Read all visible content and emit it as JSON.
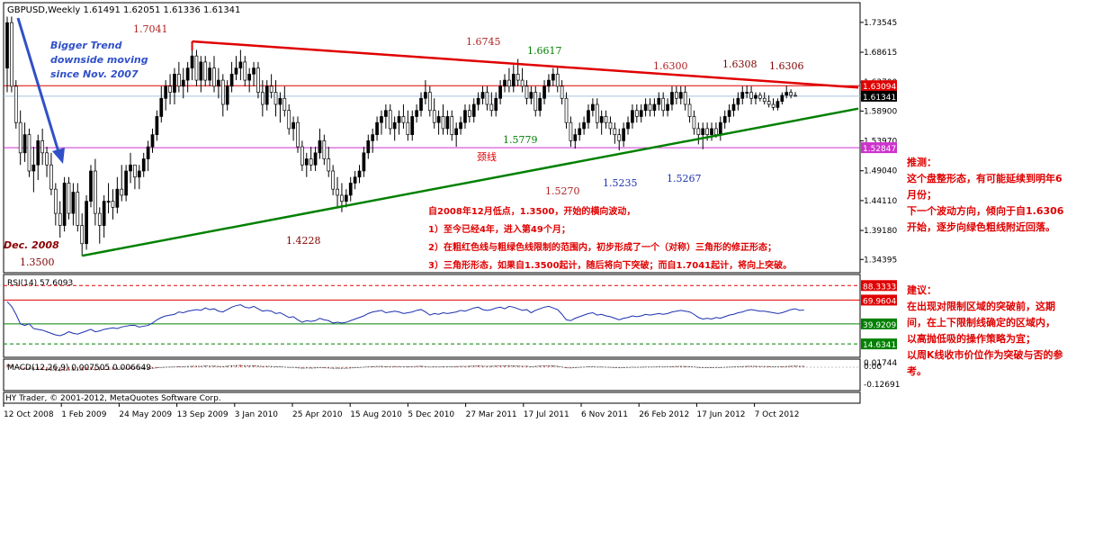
{
  "chart_data": {
    "type": "candlestick",
    "symbol_header": "GBPUSD,Weekly  1.61491 1.62051 1.61336 1.61341",
    "rsi_header": "RSI(14) 57.6093",
    "macd_header": "MACD(12,26,9) 0.007505 0.006649",
    "footer": "HY Trader, © 2001-2012, MetaQuotes Software Corp.",
    "price_range": [
      1.325,
      1.765
    ],
    "price_ticks": [
      "1.73545",
      "1.68615",
      "1.63700",
      "1.58900",
      "1.53970",
      "1.49040",
      "1.44110",
      "1.39180",
      "1.34395"
    ],
    "x_labels": [
      "12 Oct 2008",
      "1 Feb 2009",
      "24 May 2009",
      "13 Sep 2009",
      "3 Jan 2010",
      "25 Apr 2010",
      "15 Aug 2010",
      "5 Dec 2010",
      "27 Mar 2011",
      "17 Jul 2011",
      "6 Nov 2011",
      "26 Feb 2012",
      "17 Jun 2012",
      "7 Oct 2012"
    ],
    "price_tags": {
      "red_line": "1.63094",
      "current": "1.61341",
      "magenta_line": "1.52847"
    },
    "rsi_tags": [
      "88.3333",
      "69.9604",
      "39.9209",
      "14.6341"
    ],
    "macd_ticks": [
      "0.01744",
      "0.00",
      "-0.12691"
    ],
    "annotations": {
      "trend_note": [
        "Bigger Trend",
        "downside moving",
        "since Nov. 2007"
      ],
      "dec_2008": "Dec. 2008",
      "price_marks": [
        "1.7041",
        "1.6745",
        "1.6617",
        "1.6300",
        "1.6308",
        "1.6306",
        "1.5779",
        "1.5270",
        "1.5235",
        "1.5267",
        "1.4228",
        "1.3500"
      ],
      "neck_label": "颈线",
      "analysis": [
        "自2008年12月低点，1.3500，开始的横向波动，",
        "1）至今已经4年，进入第49个月；",
        "2）在粗红色线与粗绿色线限制的范围内，初步形成了一个（对称）三角形的修正形态；",
        "3）三角形形态，如果自1.3500起计，随后将向下突破；而自1.7041起计，将向上突破。"
      ]
    },
    "candles": [
      [
        1.66,
        1.745,
        1.62,
        1.735
      ],
      [
        1.735,
        1.745,
        1.62,
        1.63
      ],
      [
        1.63,
        1.64,
        1.56,
        1.57
      ],
      [
        1.57,
        1.59,
        1.5,
        1.52
      ],
      [
        1.52,
        1.57,
        1.505,
        1.55
      ],
      [
        1.55,
        1.56,
        1.48,
        1.49
      ],
      [
        1.49,
        1.53,
        1.455,
        1.5
      ],
      [
        1.5,
        1.55,
        1.475,
        1.54
      ],
      [
        1.54,
        1.56,
        1.5,
        1.52
      ],
      [
        1.52,
        1.53,
        1.48,
        1.5
      ],
      [
        1.5,
        1.52,
        1.45,
        1.46
      ],
      [
        1.46,
        1.47,
        1.4,
        1.42
      ],
      [
        1.42,
        1.44,
        1.38,
        1.4
      ],
      [
        1.4,
        1.48,
        1.39,
        1.47
      ],
      [
        1.47,
        1.48,
        1.41,
        1.42
      ],
      [
        1.42,
        1.47,
        1.4,
        1.455
      ],
      [
        1.455,
        1.47,
        1.39,
        1.4
      ],
      [
        1.4,
        1.42,
        1.35,
        1.37
      ],
      [
        1.37,
        1.45,
        1.36,
        1.44
      ],
      [
        1.44,
        1.5,
        1.43,
        1.49
      ],
      [
        1.49,
        1.51,
        1.4,
        1.42
      ],
      [
        1.42,
        1.43,
        1.37,
        1.4
      ],
      [
        1.4,
        1.45,
        1.38,
        1.44
      ],
      [
        1.44,
        1.47,
        1.42,
        1.44
      ],
      [
        1.44,
        1.46,
        1.41,
        1.43
      ],
      [
        1.43,
        1.48,
        1.42,
        1.46
      ],
      [
        1.46,
        1.5,
        1.44,
        1.45
      ],
      [
        1.45,
        1.5,
        1.44,
        1.49
      ],
      [
        1.49,
        1.52,
        1.47,
        1.5
      ],
      [
        1.5,
        1.5,
        1.46,
        1.48
      ],
      [
        1.48,
        1.5,
        1.46,
        1.49
      ],
      [
        1.49,
        1.52,
        1.48,
        1.51
      ],
      [
        1.51,
        1.54,
        1.49,
        1.53
      ],
      [
        1.53,
        1.56,
        1.52,
        1.55
      ],
      [
        1.55,
        1.59,
        1.54,
        1.58
      ],
      [
        1.58,
        1.63,
        1.57,
        1.61
      ],
      [
        1.61,
        1.64,
        1.59,
        1.63
      ],
      [
        1.63,
        1.65,
        1.6,
        1.62
      ],
      [
        1.62,
        1.66,
        1.6,
        1.65
      ],
      [
        1.65,
        1.67,
        1.62,
        1.63
      ],
      [
        1.63,
        1.66,
        1.61,
        1.64
      ],
      [
        1.64,
        1.67,
        1.62,
        1.66
      ],
      [
        1.66,
        1.7,
        1.64,
        1.68
      ],
      [
        1.68,
        1.69,
        1.63,
        1.64
      ],
      [
        1.64,
        1.68,
        1.62,
        1.67
      ],
      [
        1.67,
        1.68,
        1.63,
        1.64
      ],
      [
        1.64,
        1.67,
        1.63,
        1.66
      ],
      [
        1.66,
        1.68,
        1.62,
        1.63
      ],
      [
        1.63,
        1.66,
        1.61,
        1.64
      ],
      [
        1.64,
        1.65,
        1.58,
        1.6
      ],
      [
        1.6,
        1.64,
        1.59,
        1.63
      ],
      [
        1.63,
        1.67,
        1.62,
        1.65
      ],
      [
        1.65,
        1.68,
        1.64,
        1.66
      ],
      [
        1.66,
        1.69,
        1.64,
        1.67
      ],
      [
        1.67,
        1.68,
        1.63,
        1.64
      ],
      [
        1.64,
        1.66,
        1.62,
        1.65
      ],
      [
        1.65,
        1.67,
        1.63,
        1.66
      ],
      [
        1.66,
        1.67,
        1.61,
        1.62
      ],
      [
        1.62,
        1.64,
        1.58,
        1.6
      ],
      [
        1.6,
        1.64,
        1.59,
        1.63
      ],
      [
        1.63,
        1.65,
        1.61,
        1.62
      ],
      [
        1.62,
        1.64,
        1.58,
        1.6
      ],
      [
        1.6,
        1.62,
        1.57,
        1.61
      ],
      [
        1.61,
        1.63,
        1.58,
        1.59
      ],
      [
        1.59,
        1.6,
        1.55,
        1.56
      ],
      [
        1.56,
        1.58,
        1.54,
        1.57
      ],
      [
        1.57,
        1.58,
        1.52,
        1.53
      ],
      [
        1.53,
        1.54,
        1.49,
        1.5
      ],
      [
        1.5,
        1.52,
        1.48,
        1.51
      ],
      [
        1.51,
        1.53,
        1.49,
        1.5
      ],
      [
        1.5,
        1.53,
        1.49,
        1.52
      ],
      [
        1.52,
        1.56,
        1.51,
        1.54
      ],
      [
        1.54,
        1.55,
        1.5,
        1.51
      ],
      [
        1.51,
        1.53,
        1.48,
        1.49
      ],
      [
        1.49,
        1.5,
        1.45,
        1.46
      ],
      [
        1.46,
        1.48,
        1.43,
        1.45
      ],
      [
        1.45,
        1.47,
        1.422,
        1.44
      ],
      [
        1.44,
        1.46,
        1.43,
        1.45
      ],
      [
        1.45,
        1.48,
        1.44,
        1.47
      ],
      [
        1.47,
        1.49,
        1.46,
        1.48
      ],
      [
        1.48,
        1.5,
        1.47,
        1.49
      ],
      [
        1.49,
        1.53,
        1.48,
        1.52
      ],
      [
        1.52,
        1.55,
        1.51,
        1.54
      ],
      [
        1.54,
        1.56,
        1.52,
        1.55
      ],
      [
        1.55,
        1.58,
        1.54,
        1.57
      ],
      [
        1.57,
        1.59,
        1.55,
        1.58
      ],
      [
        1.58,
        1.6,
        1.56,
        1.59
      ],
      [
        1.59,
        1.6,
        1.55,
        1.56
      ],
      [
        1.56,
        1.58,
        1.54,
        1.57
      ],
      [
        1.57,
        1.59,
        1.55,
        1.58
      ],
      [
        1.58,
        1.6,
        1.56,
        1.57
      ],
      [
        1.57,
        1.59,
        1.54,
        1.55
      ],
      [
        1.55,
        1.59,
        1.54,
        1.58
      ],
      [
        1.58,
        1.6,
        1.57,
        1.59
      ],
      [
        1.59,
        1.62,
        1.58,
        1.61
      ],
      [
        1.61,
        1.64,
        1.6,
        1.62
      ],
      [
        1.62,
        1.63,
        1.58,
        1.59
      ],
      [
        1.59,
        1.61,
        1.56,
        1.57
      ],
      [
        1.57,
        1.59,
        1.55,
        1.58
      ],
      [
        1.58,
        1.6,
        1.55,
        1.56
      ],
      [
        1.56,
        1.59,
        1.55,
        1.58
      ],
      [
        1.58,
        1.59,
        1.54,
        1.55
      ],
      [
        1.55,
        1.57,
        1.53,
        1.56
      ],
      [
        1.56,
        1.58,
        1.55,
        1.57
      ],
      [
        1.57,
        1.6,
        1.56,
        1.59
      ],
      [
        1.59,
        1.6,
        1.57,
        1.58
      ],
      [
        1.58,
        1.61,
        1.57,
        1.6
      ],
      [
        1.6,
        1.62,
        1.59,
        1.61
      ],
      [
        1.61,
        1.63,
        1.6,
        1.62
      ],
      [
        1.62,
        1.63,
        1.59,
        1.6
      ],
      [
        1.6,
        1.62,
        1.58,
        1.59
      ],
      [
        1.59,
        1.62,
        1.58,
        1.61
      ],
      [
        1.61,
        1.64,
        1.6,
        1.63
      ],
      [
        1.63,
        1.65,
        1.62,
        1.64
      ],
      [
        1.64,
        1.66,
        1.62,
        1.63
      ],
      [
        1.63,
        1.665,
        1.62,
        1.65
      ],
      [
        1.65,
        1.675,
        1.63,
        1.64
      ],
      [
        1.64,
        1.66,
        1.62,
        1.63
      ],
      [
        1.63,
        1.64,
        1.6,
        1.61
      ],
      [
        1.61,
        1.63,
        1.6,
        1.62
      ],
      [
        1.62,
        1.63,
        1.58,
        1.59
      ],
      [
        1.59,
        1.62,
        1.58,
        1.61
      ],
      [
        1.61,
        1.64,
        1.6,
        1.63
      ],
      [
        1.63,
        1.65,
        1.62,
        1.64
      ],
      [
        1.64,
        1.66,
        1.63,
        1.65
      ],
      [
        1.65,
        1.662,
        1.62,
        1.63
      ],
      [
        1.63,
        1.64,
        1.6,
        1.61
      ],
      [
        1.61,
        1.62,
        1.56,
        1.57
      ],
      [
        1.57,
        1.58,
        1.53,
        1.54
      ],
      [
        1.54,
        1.56,
        1.527,
        1.55
      ],
      [
        1.55,
        1.57,
        1.54,
        1.56
      ],
      [
        1.56,
        1.58,
        1.55,
        1.57
      ],
      [
        1.57,
        1.6,
        1.56,
        1.59
      ],
      [
        1.59,
        1.61,
        1.58,
        1.6
      ],
      [
        1.6,
        1.61,
        1.56,
        1.57
      ],
      [
        1.57,
        1.59,
        1.55,
        1.58
      ],
      [
        1.58,
        1.59,
        1.56,
        1.57
      ],
      [
        1.57,
        1.58,
        1.55,
        1.56
      ],
      [
        1.56,
        1.57,
        1.535,
        1.55
      ],
      [
        1.55,
        1.56,
        1.524,
        1.54
      ],
      [
        1.54,
        1.57,
        1.53,
        1.56
      ],
      [
        1.56,
        1.58,
        1.55,
        1.57
      ],
      [
        1.57,
        1.6,
        1.56,
        1.59
      ],
      [
        1.59,
        1.6,
        1.57,
        1.58
      ],
      [
        1.58,
        1.6,
        1.57,
        1.59
      ],
      [
        1.59,
        1.61,
        1.58,
        1.6
      ],
      [
        1.6,
        1.61,
        1.58,
        1.59
      ],
      [
        1.59,
        1.61,
        1.58,
        1.6
      ],
      [
        1.6,
        1.62,
        1.59,
        1.61
      ],
      [
        1.61,
        1.62,
        1.58,
        1.59
      ],
      [
        1.59,
        1.61,
        1.58,
        1.6
      ],
      [
        1.6,
        1.63,
        1.59,
        1.62
      ],
      [
        1.62,
        1.63,
        1.6,
        1.61
      ],
      [
        1.61,
        1.63,
        1.6,
        1.62
      ],
      [
        1.62,
        1.63,
        1.59,
        1.6
      ],
      [
        1.6,
        1.61,
        1.57,
        1.58
      ],
      [
        1.58,
        1.59,
        1.55,
        1.56
      ],
      [
        1.56,
        1.57,
        1.534,
        1.55
      ],
      [
        1.55,
        1.57,
        1.526,
        1.56
      ],
      [
        1.56,
        1.57,
        1.54,
        1.55
      ],
      [
        1.55,
        1.57,
        1.54,
        1.56
      ],
      [
        1.56,
        1.57,
        1.545,
        1.55
      ],
      [
        1.55,
        1.58,
        1.54,
        1.57
      ],
      [
        1.57,
        1.59,
        1.56,
        1.58
      ],
      [
        1.58,
        1.6,
        1.57,
        1.59
      ],
      [
        1.59,
        1.61,
        1.58,
        1.6
      ],
      [
        1.6,
        1.62,
        1.59,
        1.61
      ],
      [
        1.61,
        1.63,
        1.6,
        1.62
      ],
      [
        1.62,
        1.631,
        1.61,
        1.62
      ],
      [
        1.62,
        1.63,
        1.6,
        1.61
      ],
      [
        1.61,
        1.62,
        1.6,
        1.615
      ],
      [
        1.615,
        1.62,
        1.605,
        1.61
      ],
      [
        1.61,
        1.62,
        1.6,
        1.605
      ],
      [
        1.605,
        1.615,
        1.595,
        1.6
      ],
      [
        1.6,
        1.61,
        1.59,
        1.595
      ],
      [
        1.595,
        1.61,
        1.59,
        1.605
      ],
      [
        1.605,
        1.62,
        1.6,
        1.615
      ],
      [
        1.615,
        1.6306,
        1.61,
        1.62
      ],
      [
        1.62,
        1.625,
        1.61,
        1.6149
      ],
      [
        1.6149,
        1.6205,
        1.6134,
        1.6134
      ]
    ],
    "rsi": [
      68,
      62,
      52,
      40,
      38,
      40,
      34,
      33,
      32,
      30,
      28,
      26,
      25,
      27,
      30,
      28,
      27,
      29,
      31,
      33,
      30,
      31,
      33,
      34,
      35,
      34,
      36,
      37,
      38,
      38,
      36,
      37,
      38,
      41,
      45,
      48,
      50,
      51,
      52,
      55,
      54,
      56,
      57,
      58,
      57,
      60,
      58,
      59,
      56,
      55,
      58,
      61,
      63,
      64,
      61,
      60,
      62,
      59,
      56,
      57,
      56,
      53,
      54,
      51,
      48,
      49,
      45,
      42,
      44,
      43,
      44,
      47,
      45,
      44,
      41,
      42,
      41,
      42,
      44,
      46,
      48,
      50,
      53,
      55,
      56,
      57,
      54,
      55,
      56,
      55,
      53,
      54,
      55,
      57,
      58,
      55,
      51,
      53,
      52,
      54,
      53,
      54,
      55,
      57,
      56,
      58,
      60,
      61,
      58,
      57,
      58,
      60,
      61,
      59,
      62,
      61,
      59,
      57,
      58,
      54,
      57,
      59,
      61,
      62,
      60,
      58,
      52,
      45,
      44,
      47,
      49,
      51,
      53,
      54,
      51,
      52,
      50,
      49,
      47,
      45,
      47,
      48,
      50,
      49,
      50,
      52,
      51,
      52,
      53,
      52,
      53,
      55,
      56,
      57,
      56,
      55,
      52,
      48,
      46,
      47,
      46,
      48,
      47,
      49,
      51,
      52,
      54,
      55,
      57,
      58,
      57,
      56,
      56,
      55,
      54,
      53,
      54,
      56,
      58,
      59,
      57,
      57.6
    ]
  },
  "notes": {
    "forecast_title": "推测：",
    "forecast_lines": [
      "这个盘整形态，有可能延续到明年6",
      "月份；",
      "下一个波动方向，倾向于自1.6306",
      "开始，逐步向绿色粗线附近回落。"
    ],
    "advice_title": "建议：",
    "advice_lines": [
      "在出现对限制区域的突破前，这期",
      "间，在上下限制线确定的区域内，",
      "以高抛低吸的操作策略为宜；",
      "以周K线收市价位作为突破与否的参",
      "考。"
    ]
  },
  "colors": {
    "bull": "#000000",
    "bear": "#ffffff",
    "resistance": "#e00000",
    "support": "#008000",
    "neckline": "#cc33cc"
  }
}
